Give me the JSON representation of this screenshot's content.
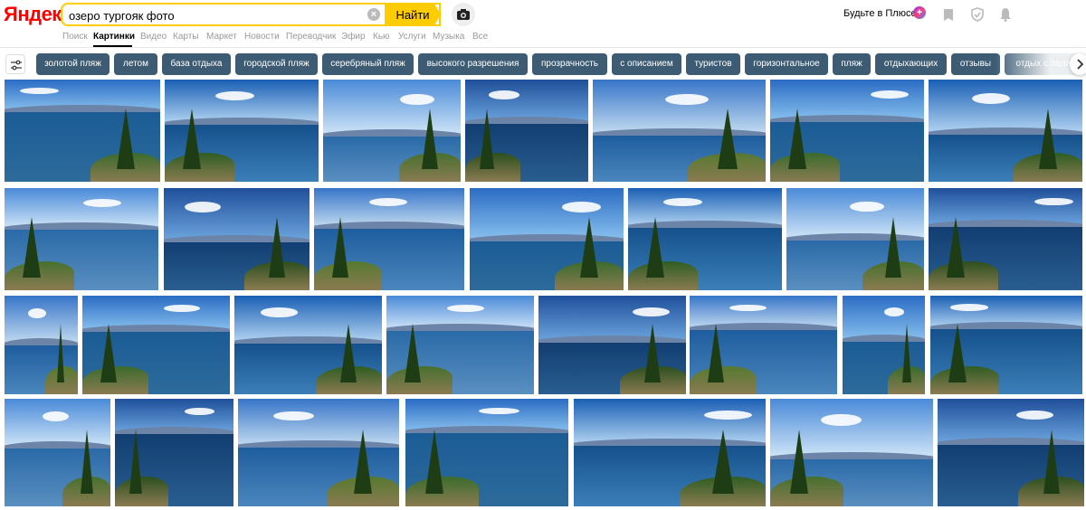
{
  "header": {
    "logo": "Яндекс",
    "search_value": "озеро тургояк фото",
    "search_button": "Найти",
    "plus_label": "Будьте в Плюсе"
  },
  "tabs": [
    {
      "label": "Поиск"
    },
    {
      "label": "Картинки",
      "active": true
    },
    {
      "label": "Видео"
    },
    {
      "label": "Карты"
    },
    {
      "label": "Маркет"
    },
    {
      "label": "Новости"
    },
    {
      "label": "Переводчик"
    },
    {
      "label": "Эфир"
    },
    {
      "label": "Кью"
    },
    {
      "label": "Услуги"
    },
    {
      "label": "Музыка"
    },
    {
      "label": "Все"
    }
  ],
  "filters": [
    "золотой пляж",
    "летом",
    "база отдыха",
    "городской пляж",
    "серебряный пляж",
    "высокого разрешения",
    "прозрачность",
    "с описанием",
    "туристов",
    "горизонтальное",
    "пляж",
    "отдыхающих",
    "отзывы",
    "отдых с палат"
  ],
  "colors": {
    "accent": "#ffcc00",
    "chip": "#3d5c73",
    "logo_red": "#ff0000"
  },
  "icons": [
    "clear-icon",
    "camera-icon",
    "plus-icon",
    "collections-icon",
    "shield-icon",
    "bell-icon",
    "settings-icon",
    "chevron-right-icon"
  ]
}
